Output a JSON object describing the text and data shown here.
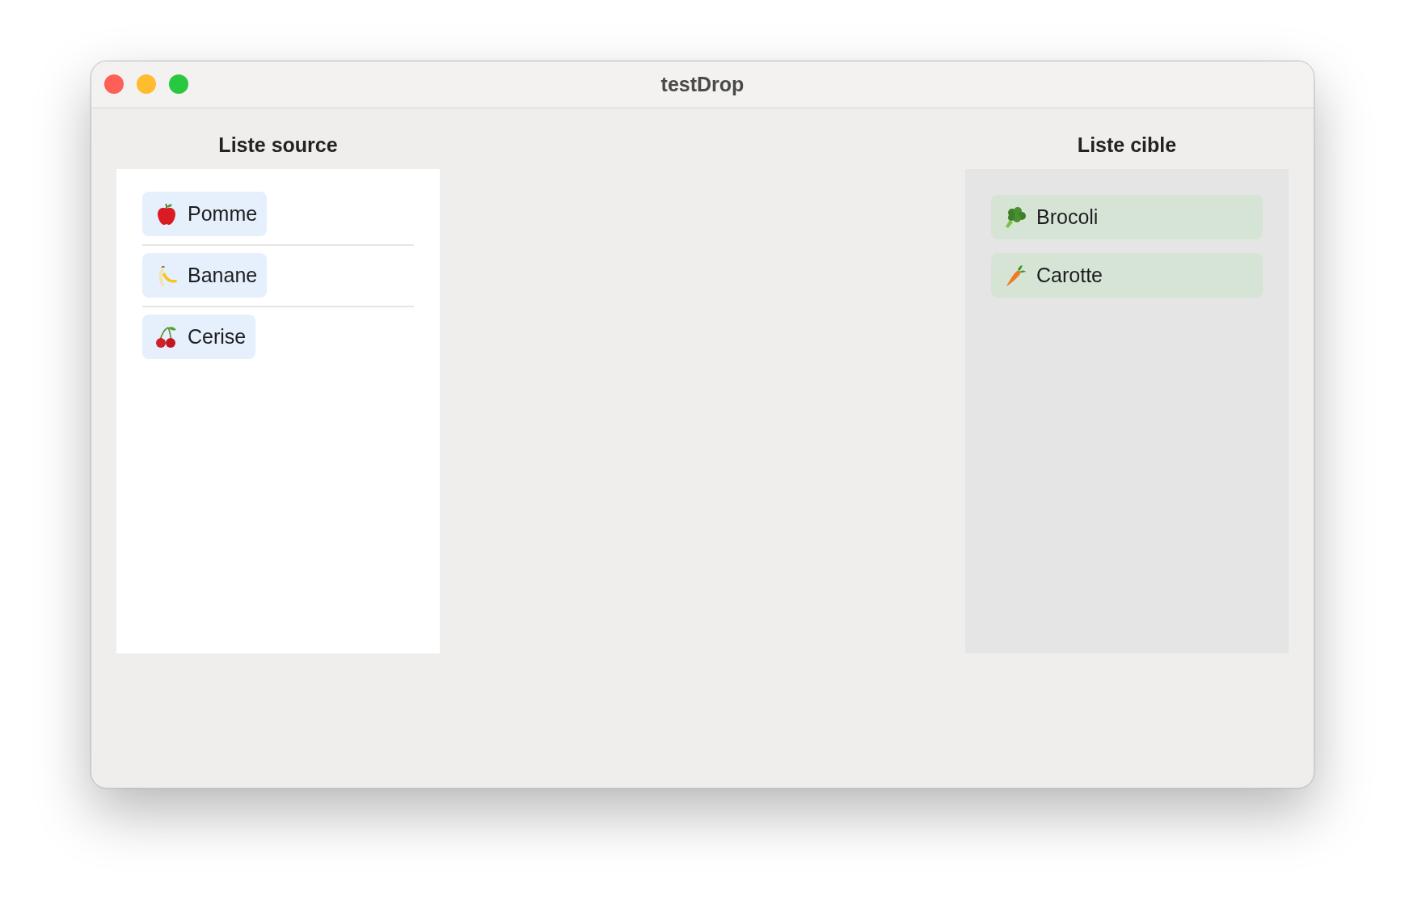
{
  "window": {
    "title": "testDrop"
  },
  "source_list": {
    "heading": "Liste source",
    "items": [
      {
        "label": "Pomme",
        "kind": "apple"
      },
      {
        "label": "Banane",
        "kind": "banana"
      },
      {
        "label": "Cerise",
        "kind": "cherry"
      }
    ]
  },
  "target_list": {
    "heading": "Liste cible",
    "items": [
      {
        "label": "Brocoli",
        "kind": "broccoli"
      },
      {
        "label": "Carotte",
        "kind": "carrot"
      }
    ]
  }
}
